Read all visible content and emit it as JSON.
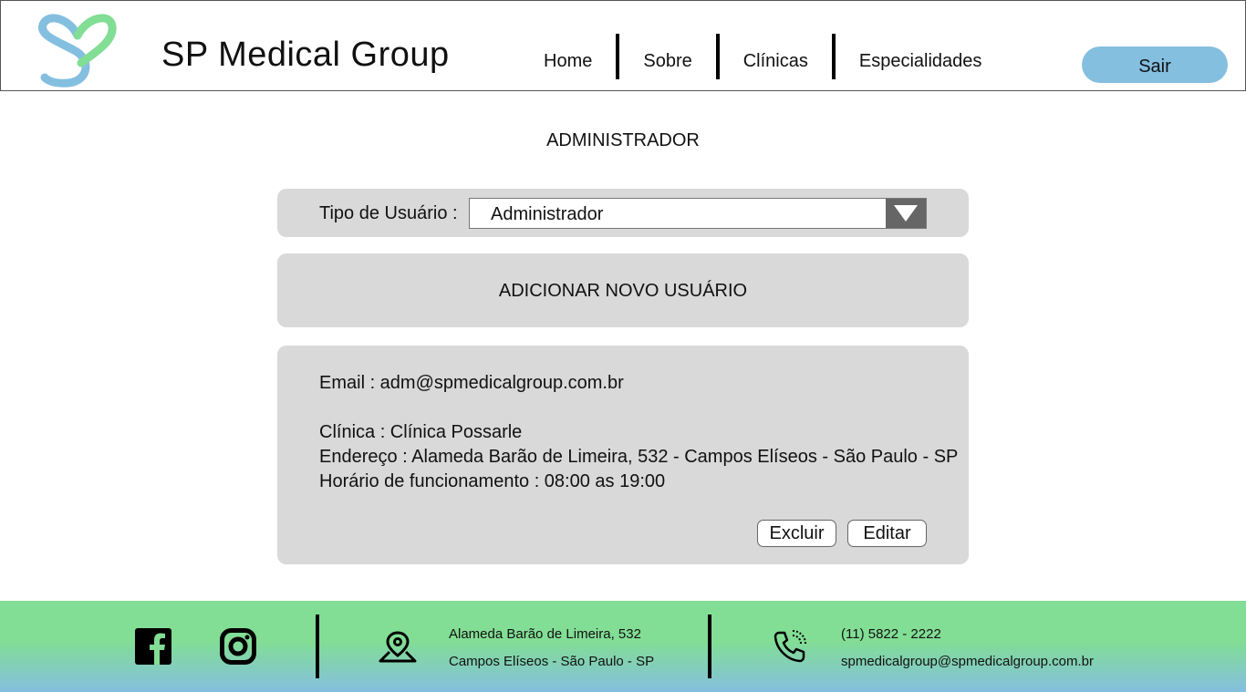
{
  "header": {
    "brand": "SP Medical Group",
    "nav": [
      {
        "label": "Home"
      },
      {
        "label": "Sobre"
      },
      {
        "label": "Clínicas"
      },
      {
        "label": "Especialidades"
      }
    ],
    "logout_label": "Sair"
  },
  "main": {
    "title": "ADMINISTRADOR",
    "user_type": {
      "label": "Tipo de Usuário :",
      "selected": "Administrador"
    },
    "add_user_label": "ADICIONAR NOVO USUÁRIO",
    "user_card": {
      "email": "Email : adm@spmedicalgroup.com.br",
      "clinic": "Clínica : Clínica Possarle",
      "address": "Endereço : Alameda Barão de Limeira, 532 - Campos Elíseos - São Paulo - SP",
      "hours": "Horário de funcionamento : 08:00 as 19:00",
      "delete_label": "Excluir",
      "edit_label": "Editar"
    }
  },
  "footer": {
    "address_line1": "Alameda Barão de Limeira, 532",
    "address_line2": "Campos Elíseos - São Paulo - SP",
    "phone": "(11) 5822 - 2222",
    "email": "spmedicalgroup@spmedicalgroup.com.br"
  },
  "icons": [
    "logo-icon",
    "facebook-icon",
    "instagram-icon",
    "map-pin-icon",
    "phone-icon",
    "dropdown-arrow-icon"
  ],
  "colors": {
    "accent_blue": "#84bfe0",
    "accent_green": "#82dd95",
    "panel_gray": "#d9d9d9"
  }
}
